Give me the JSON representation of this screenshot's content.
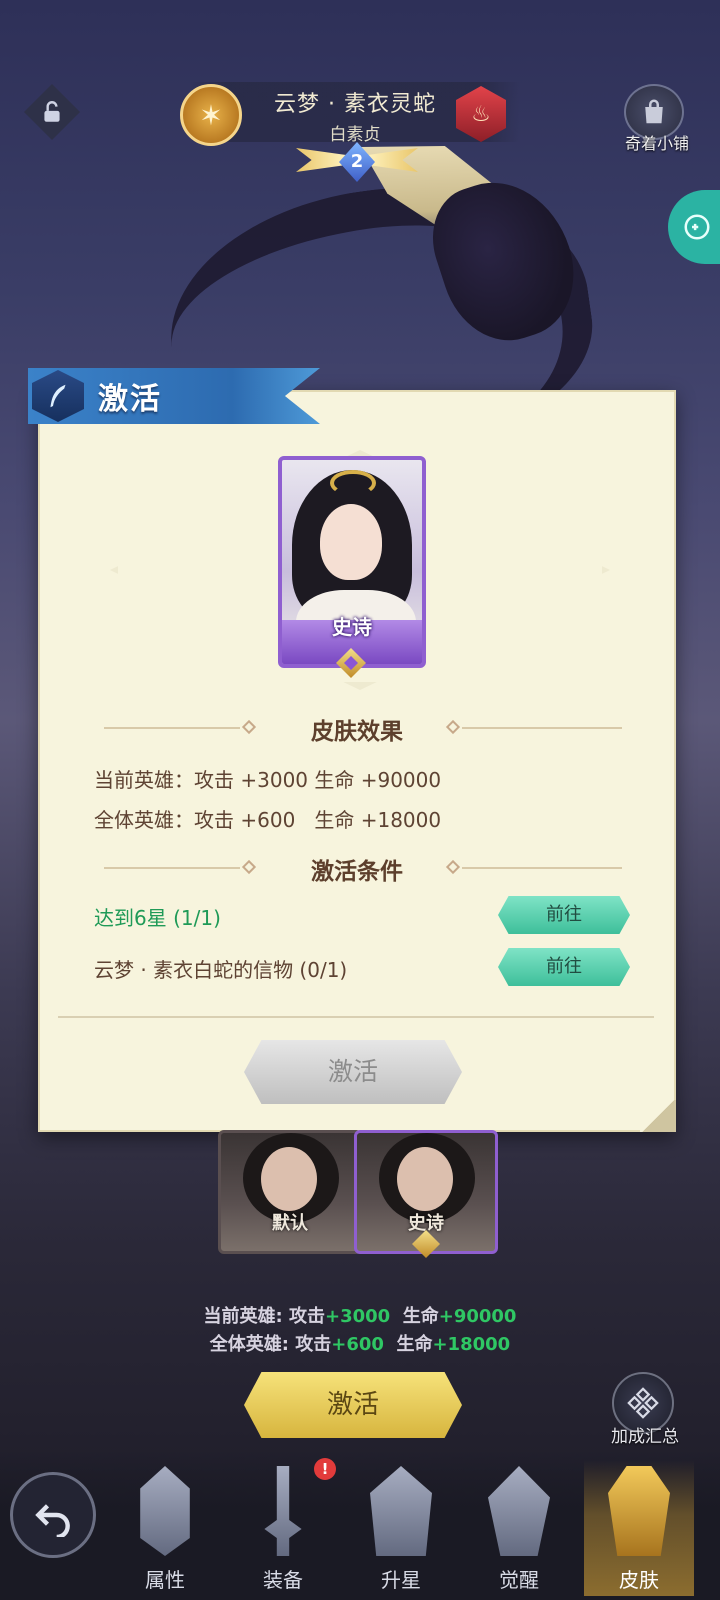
{
  "header": {
    "title": "云梦 · 素衣灵蛇",
    "subtitle": "白素贞",
    "star_level": "2",
    "shop_label": "奇着小铺"
  },
  "modal": {
    "title": "激活",
    "card_rarity": "史诗",
    "effect_section_title": "皮肤效果",
    "effects": [
      "当前英雄：攻击 +3000 生命 +90000",
      "全体英雄：攻击 +600   生命 +18000"
    ],
    "condition_section_title": "激活条件",
    "conditions": [
      {
        "text": "达到6星 (1/1)",
        "button": "前往",
        "done": true
      },
      {
        "text": "云梦 · 素衣白蛇的信物 (0/1)",
        "button": "前往",
        "done": false
      }
    ],
    "activate_label": "激活"
  },
  "skins": [
    {
      "label": "默认"
    },
    {
      "label": "史诗"
    }
  ],
  "bonus": {
    "current_prefix": "当前英雄: 攻击",
    "current_attack": "+3000",
    "current_hp_label": "生命",
    "current_hp": "+90000",
    "all_prefix": "全体英雄: 攻击",
    "all_attack": "+600",
    "all_hp_label": "生命",
    "all_hp": "+18000"
  },
  "activate_button": "激活",
  "summary_label": "加成汇总",
  "nav": {
    "items": [
      {
        "label": "属性"
      },
      {
        "label": "装备",
        "badge": "!"
      },
      {
        "label": "升星"
      },
      {
        "label": "觉醒"
      },
      {
        "label": "皮肤"
      }
    ],
    "active_index": 4
  },
  "colors": {
    "accent_gold": "#d7b53e",
    "modal_bg": "#f7f4dd",
    "condition_done": "#1f9a57",
    "goto_button": "#3ebf9a",
    "epic_purple": "#8f5fd0"
  }
}
